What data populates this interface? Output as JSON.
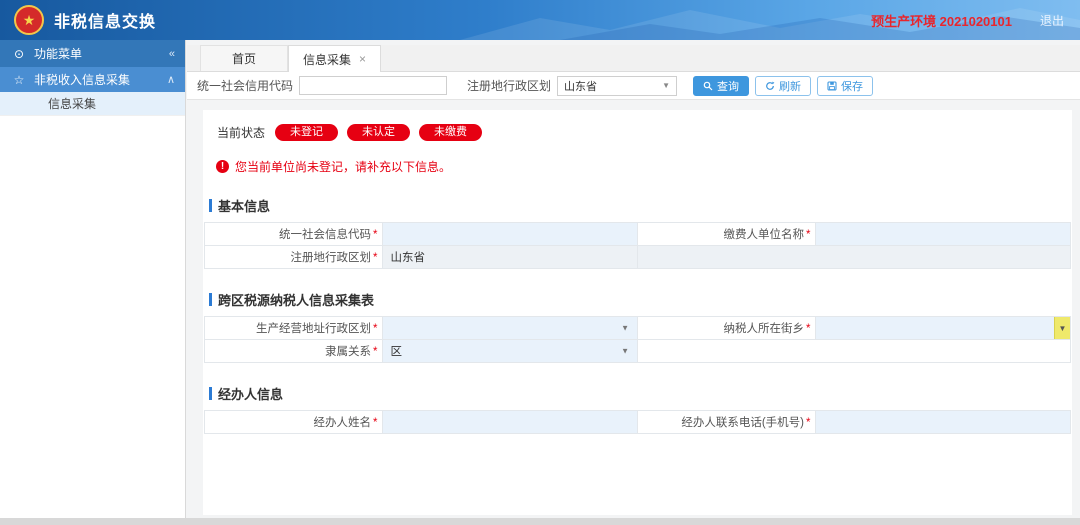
{
  "header": {
    "title": "非税信息交换",
    "env_label": "预生产环境 2021020101",
    "logout": "退出"
  },
  "sidebar": {
    "menu_title": "功能菜单",
    "group_label": "非税收入信息采集",
    "items": [
      {
        "label": "信息采集",
        "selected": true
      }
    ]
  },
  "tabs": [
    {
      "label": "首页",
      "active": false
    },
    {
      "label": "信息采集",
      "active": true,
      "closable": true
    }
  ],
  "search": {
    "credit_code_label": "统一社会信用代码",
    "credit_code_value": "",
    "region_label": "注册地行政区划",
    "region_value": "山东省",
    "query_label": "查询",
    "refresh_label": "刷新",
    "save_label": "保存"
  },
  "status": {
    "label": "当前状态",
    "badges": [
      "未登记",
      "未认定",
      "未缴费"
    ],
    "warning": "您当前单位尚未登记，请补充以下信息。"
  },
  "form": {
    "required_mark": "*",
    "basic": {
      "title": "基本信息",
      "credit_code_label": "统一社会信息代码",
      "credit_code_value": "",
      "payer_name_label": "缴费人单位名称",
      "payer_name_value": "",
      "region_label": "注册地行政区划",
      "region_value": "山东省"
    },
    "cross_region": {
      "title": "跨区税源纳税人信息采集表",
      "address_label": "生产经营地址行政区划",
      "address_value": "",
      "street_label": "纳税人所在街乡",
      "street_value": "",
      "affiliation_label": "隶属关系",
      "affiliation_value": "区"
    },
    "agent": {
      "title": "经办人信息",
      "name_label": "经办人姓名",
      "name_value": "",
      "phone_label": "经办人联系电话(手机号)",
      "phone_value": ""
    }
  },
  "icons": {
    "emblem_star": "★",
    "menu": "⊙",
    "star": "☆",
    "collapse": "«",
    "chevron_up": "∧",
    "close": "×",
    "dropdown": "▼",
    "warning": "!"
  },
  "colors": {
    "accent_blue": "#3e97de",
    "badge_red": "#e60012",
    "header_blue_dark": "#17599f",
    "header_blue_light": "#7fbdf0",
    "input_cell_blue": "#e9f2fb",
    "highlight_yellow": "#efe96b"
  }
}
